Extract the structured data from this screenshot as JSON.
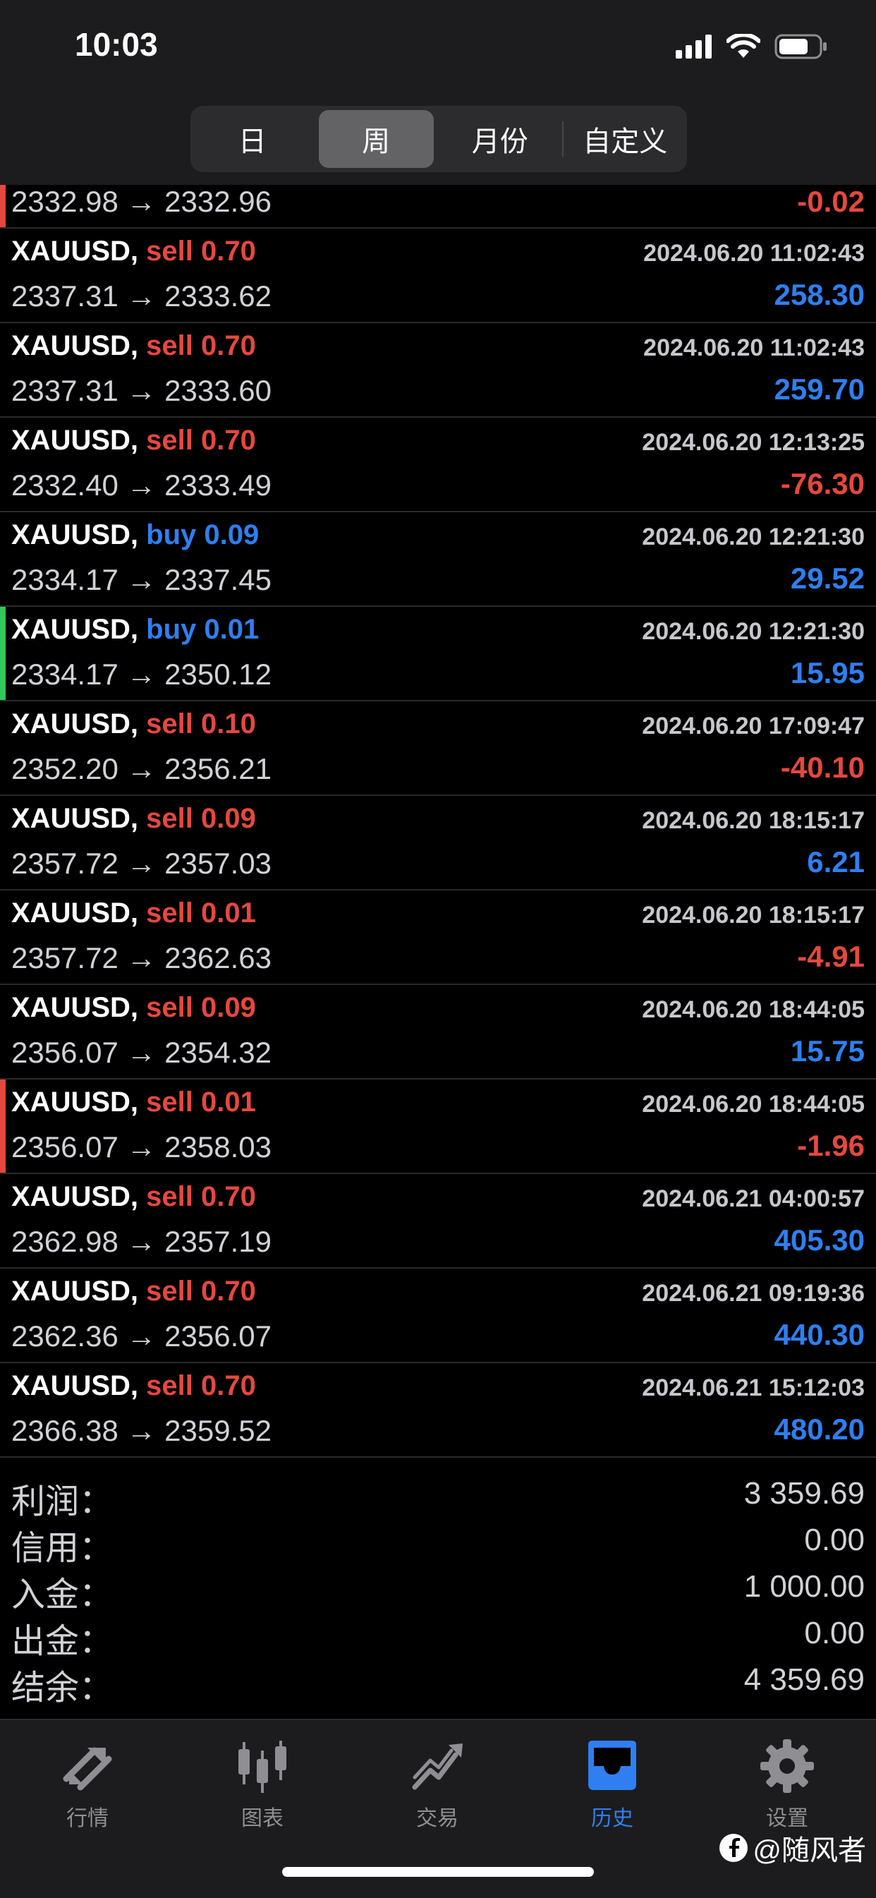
{
  "status": {
    "time": "10:03"
  },
  "segments": [
    {
      "label": "日",
      "active": false
    },
    {
      "label": "周",
      "active": true
    },
    {
      "label": "月份",
      "active": false
    },
    {
      "label": "自定义",
      "active": false
    }
  ],
  "first_row": {
    "prices": "2332.98 → 2332.96",
    "pl": "-0.02",
    "accent": "#e5483f"
  },
  "trades": [
    {
      "symbol": "XAUUSD,",
      "side": "sell 0.70",
      "time": "2024.06.20 11:02:43",
      "prices": "2337.31 → 2333.62",
      "pl": "258.30",
      "side_color": "red",
      "pl_color": "blue",
      "accent": ""
    },
    {
      "symbol": "XAUUSD,",
      "side": "sell 0.70",
      "time": "2024.06.20 11:02:43",
      "prices": "2337.31 → 2333.60",
      "pl": "259.70",
      "side_color": "red",
      "pl_color": "blue",
      "accent": ""
    },
    {
      "symbol": "XAUUSD,",
      "side": "sell 0.70",
      "time": "2024.06.20 12:13:25",
      "prices": "2332.40 → 2333.49",
      "pl": "-76.30",
      "side_color": "red",
      "pl_color": "red",
      "accent": ""
    },
    {
      "symbol": "XAUUSD,",
      "side": "buy 0.09",
      "time": "2024.06.20 12:21:30",
      "prices": "2334.17 → 2337.45",
      "pl": "29.52",
      "side_color": "blue",
      "pl_color": "blue",
      "accent": ""
    },
    {
      "symbol": "XAUUSD,",
      "side": "buy 0.01",
      "time": "2024.06.20 12:21:30",
      "prices": "2334.17 → 2350.12",
      "pl": "15.95",
      "side_color": "blue",
      "pl_color": "blue",
      "accent": "#34c759"
    },
    {
      "symbol": "XAUUSD,",
      "side": "sell 0.10",
      "time": "2024.06.20 17:09:47",
      "prices": "2352.20 → 2356.21",
      "pl": "-40.10",
      "side_color": "red",
      "pl_color": "red",
      "accent": ""
    },
    {
      "symbol": "XAUUSD,",
      "side": "sell 0.09",
      "time": "2024.06.20 18:15:17",
      "prices": "2357.72 → 2357.03",
      "pl": "6.21",
      "side_color": "red",
      "pl_color": "blue",
      "accent": ""
    },
    {
      "symbol": "XAUUSD,",
      "side": "sell 0.01",
      "time": "2024.06.20 18:15:17",
      "prices": "2357.72 → 2362.63",
      "pl": "-4.91",
      "side_color": "red",
      "pl_color": "red",
      "accent": ""
    },
    {
      "symbol": "XAUUSD,",
      "side": "sell 0.09",
      "time": "2024.06.20 18:44:05",
      "prices": "2356.07 → 2354.32",
      "pl": "15.75",
      "side_color": "red",
      "pl_color": "blue",
      "accent": ""
    },
    {
      "symbol": "XAUUSD,",
      "side": "sell 0.01",
      "time": "2024.06.20 18:44:05",
      "prices": "2356.07 → 2358.03",
      "pl": "-1.96",
      "side_color": "red",
      "pl_color": "red",
      "accent": "#e5483f"
    },
    {
      "symbol": "XAUUSD,",
      "side": "sell 0.70",
      "time": "2024.06.21 04:00:57",
      "prices": "2362.98 → 2357.19",
      "pl": "405.30",
      "side_color": "red",
      "pl_color": "blue",
      "accent": ""
    },
    {
      "symbol": "XAUUSD,",
      "side": "sell 0.70",
      "time": "2024.06.21 09:19:36",
      "prices": "2362.36 → 2356.07",
      "pl": "440.30",
      "side_color": "red",
      "pl_color": "blue",
      "accent": ""
    },
    {
      "symbol": "XAUUSD,",
      "side": "sell 0.70",
      "time": "2024.06.21 15:12:03",
      "prices": "2366.38 → 2359.52",
      "pl": "480.20",
      "side_color": "red",
      "pl_color": "blue",
      "accent": ""
    }
  ],
  "summary": [
    {
      "label": "利润：",
      "value": "3 359.69"
    },
    {
      "label": "信用：",
      "value": "0.00"
    },
    {
      "label": "入金：",
      "value": "1 000.00"
    },
    {
      "label": "出金：",
      "value": "0.00"
    },
    {
      "label": "结余：",
      "value": "4 359.69"
    }
  ],
  "tabs": [
    {
      "label": "行情",
      "icon": "quotes-arrows-icon",
      "active": false
    },
    {
      "label": "图表",
      "icon": "candlestick-chart-icon",
      "active": false
    },
    {
      "label": "交易",
      "icon": "trade-trend-icon",
      "active": false
    },
    {
      "label": "历史",
      "icon": "history-inbox-icon",
      "active": true
    },
    {
      "label": "设置",
      "icon": "gear-icon",
      "active": false
    }
  ],
  "watermark": "@随风者",
  "colors": {
    "red": "#e5483f",
    "blue": "#2f7ff0",
    "green": "#34c759",
    "bg": "#000000",
    "panel": "#1c1c1e"
  }
}
